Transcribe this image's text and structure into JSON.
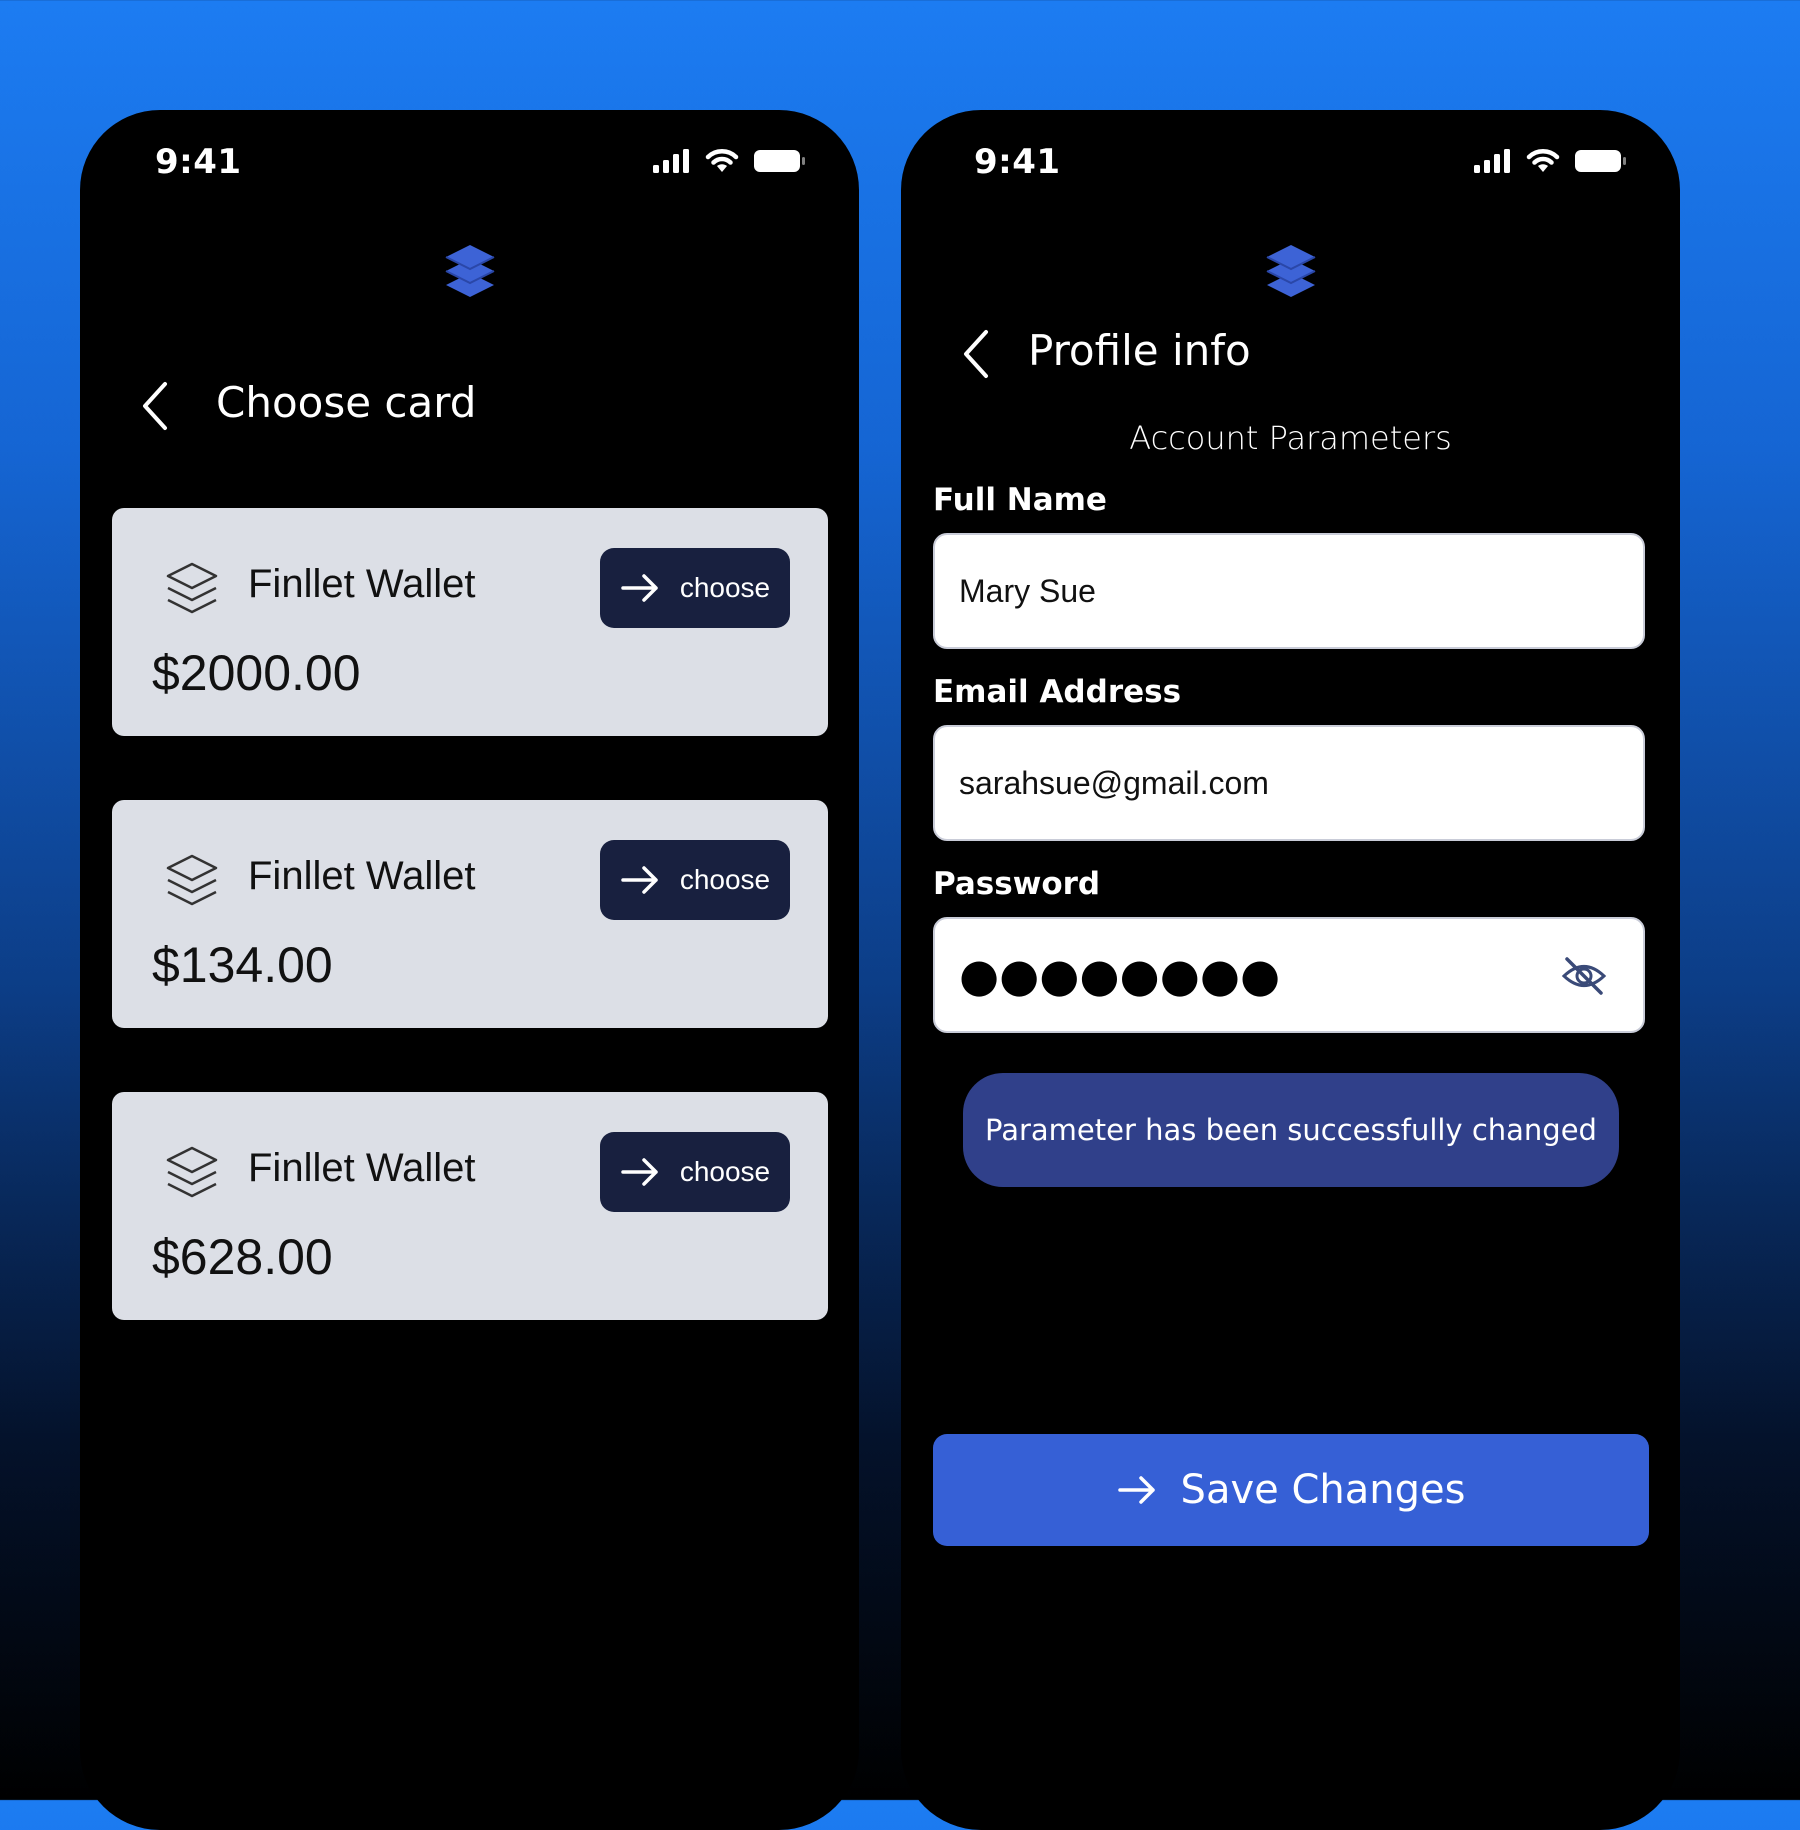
{
  "colors": {
    "accent": "#3660d6",
    "choose_button_bg": "#18203f",
    "card_bg": "#dcdfe6",
    "toast_bg": "#30408a",
    "logo": "#3d63d6"
  },
  "left_phone": {
    "status": {
      "time": "9:41"
    },
    "logo_icon": "stacked-layers-icon",
    "back_icon": "chevron-left-icon",
    "title": "Choose card",
    "cards": [
      {
        "icon": "stack-outline-icon",
        "name": "Finllet Wallet",
        "amount": "$2000.00",
        "button_label": "choose"
      },
      {
        "icon": "stack-outline-icon",
        "name": "Finllet Wallet",
        "amount": "$134.00",
        "button_label": "choose"
      },
      {
        "icon": "stack-outline-icon",
        "name": "Finllet Wallet",
        "amount": "$628.00",
        "button_label": "choose"
      }
    ]
  },
  "right_phone": {
    "status": {
      "time": "9:41"
    },
    "logo_icon": "stacked-layers-icon",
    "back_icon": "chevron-left-icon",
    "title": "Profile info",
    "section_title": "Account Parameters",
    "fields": {
      "full_name": {
        "label": "Full Name",
        "value": "Mary Sue"
      },
      "email": {
        "label": "Email Address",
        "value": "sarahsue@gmail.com"
      },
      "password": {
        "label": "Password",
        "value": "●●●●●●●●",
        "toggle_icon": "eye-off-icon"
      }
    },
    "toast": "Parameter has been successfully changed",
    "save_label": "Save Changes"
  }
}
